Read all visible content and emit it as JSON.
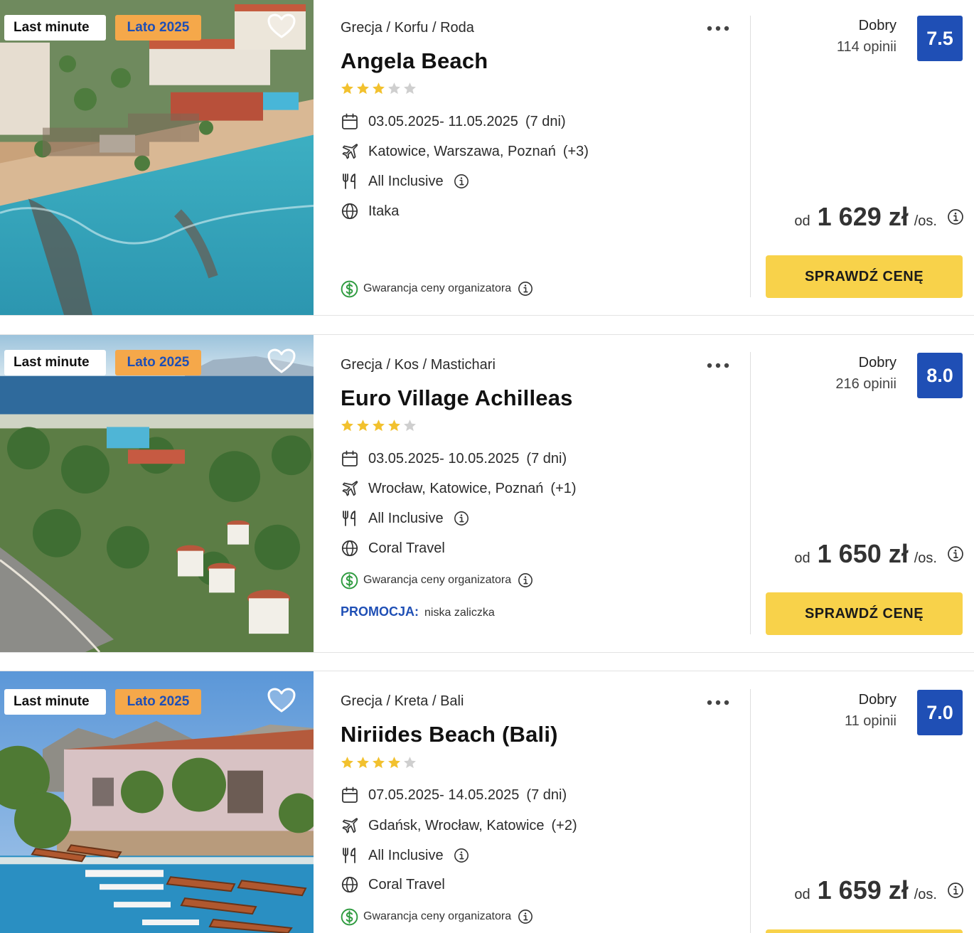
{
  "icons": {
    "heart": "heart-icon",
    "more": "more-options-icon",
    "calendar": "calendar-icon",
    "flight": "airplane-icon",
    "board": "cutlery-icon",
    "operator": "globe-icon",
    "info": "info-icon",
    "guarantee": "dollar-circle-icon",
    "star": "star-icon"
  },
  "colors": {
    "accent_blue": "#1f4fb5",
    "cta_yellow": "#f8d24a",
    "badge_orange": "#f5a84a",
    "star_gold": "#f2c12e",
    "star_gray": "#cfcfcf",
    "guarantee_green": "#2e9b3f"
  },
  "offers": [
    {
      "badges": {
        "last_minute": "Last minute",
        "season": "Lato 2025"
      },
      "breadcrumb": {
        "country": "Grecja",
        "region": "Korfu",
        "city": "Roda",
        "sep": "/"
      },
      "name": "Angela Beach",
      "stars": 3,
      "dates": "03.05.2025- 11.05.2025",
      "duration": "(7 dni)",
      "departures": "Katowice, Warszawa, Poznań",
      "departures_more": "(+3)",
      "board": "All Inclusive",
      "operator": "Itaka",
      "guarantee": "Gwarancja ceny organizatora",
      "rating_label": "Dobry",
      "reviews": "114 opinii",
      "score": "7.5",
      "price_prefix": "od",
      "price": "1 629 zł",
      "price_suffix": "/os.",
      "cta": "SPRAWDŹ CENĘ"
    },
    {
      "badges": {
        "last_minute": "Last minute",
        "season": "Lato 2025"
      },
      "breadcrumb": {
        "country": "Grecja",
        "region": "Kos",
        "city": "Mastichari",
        "sep": "/"
      },
      "name": "Euro Village Achilleas",
      "stars": 4,
      "dates": "03.05.2025- 10.05.2025",
      "duration": "(7 dni)",
      "departures": "Wrocław, Katowice, Poznań",
      "departures_more": "(+1)",
      "board": "All Inclusive",
      "operator": "Coral Travel",
      "guarantee": "Gwarancja ceny organizatora",
      "promo_label": "PROMOCJA:",
      "promo_text": "niska zaliczka",
      "rating_label": "Dobry",
      "reviews": "216 opinii",
      "score": "8.0",
      "price_prefix": "od",
      "price": "1 650 zł",
      "price_suffix": "/os.",
      "cta": "SPRAWDŹ CENĘ"
    },
    {
      "badges": {
        "last_minute": "Last minute",
        "season": "Lato 2025"
      },
      "breadcrumb": {
        "country": "Grecja",
        "region": "Kreta",
        "city": "Bali",
        "sep": "/"
      },
      "name": "Niriides Beach (Bali)",
      "stars": 4,
      "dates": "07.05.2025- 14.05.2025",
      "duration": "(7 dni)",
      "departures": "Gdańsk, Wrocław, Katowice",
      "departures_more": "(+2)",
      "board": "All Inclusive",
      "operator": "Coral Travel",
      "guarantee": "Gwarancja ceny organizatora",
      "rating_label": "Dobry",
      "reviews": "11 opinii",
      "score": "7.0",
      "price_prefix": "od",
      "price": "1 659 zł",
      "price_suffix": "/os."
    }
  ]
}
